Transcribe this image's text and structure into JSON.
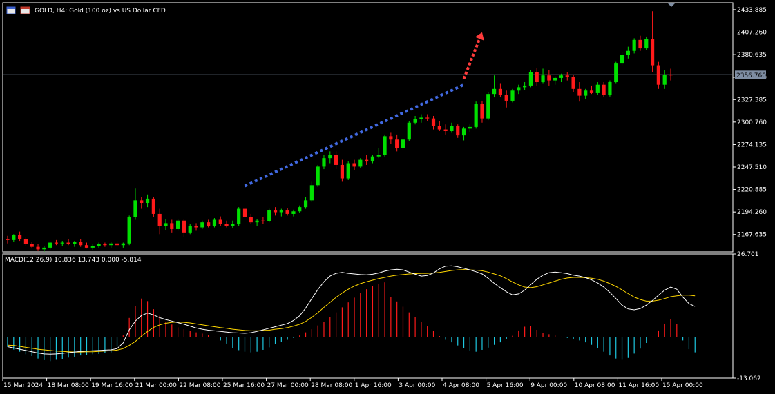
{
  "header": {
    "title": "GOLD, H4:  Gold (100 oz) vs US Dollar CFD"
  },
  "colors": {
    "background": "#000000",
    "bull": "#00e000",
    "bear": "#ff1a1a",
    "grid": "#6e6e6e",
    "current_price_line": "#7f8ea3",
    "support_trendline": "#4169e1",
    "projection_arrow": "#ff3b3b",
    "macd_main": "#ffffff",
    "macd_signal": "#ffd700",
    "hist_positive": "#ff1a1a",
    "hist_negative": "#1ec8e0"
  },
  "price_panel": {
    "current_price": "2356.760",
    "y_ticks": [
      "2433.885",
      "2407.260",
      "2380.635",
      "2353.760",
      "2327.385",
      "2300.760",
      "2274.135",
      "2247.510",
      "2220.885",
      "2194.260",
      "2167.635"
    ]
  },
  "macd_panel": {
    "label": "MACD(12,26,9) 10.836 13.743 0.000 -5.814",
    "y_ticks": [
      "26.701",
      "-13.062"
    ]
  },
  "x_axis": {
    "labels": [
      "15 Mar 2024",
      "18 Mar 08:00",
      "19 Mar 16:00",
      "21 Mar 00:00",
      "22 Mar 08:00",
      "25 Mar 16:00",
      "27 Mar 00:00",
      "28 Mar 08:00",
      "1 Apr 16:00",
      "3 Apr 00:00",
      "4 Apr 08:00",
      "5 Apr 16:00",
      "9 Apr 00:00",
      "10 Apr 08:00",
      "11 Apr 16:00",
      "15 Apr 00:00"
    ]
  },
  "chart_data": [
    {
      "type": "candlestick",
      "title": "GOLD, H4:  Gold (100 oz) vs US Dollar CFD",
      "x_labels": [
        "15 Mar 2024",
        "18 Mar 08:00",
        "19 Mar 16:00",
        "21 Mar 00:00",
        "22 Mar 08:00",
        "25 Mar 16:00",
        "27 Mar 00:00",
        "28 Mar 08:00",
        "1 Apr 16:00",
        "3 Apr 00:00",
        "4 Apr 08:00",
        "5 Apr 16:00",
        "9 Apr 00:00",
        "10 Apr 08:00",
        "11 Apr 16:00",
        "15 Apr 00:00"
      ],
      "ylim": [
        2147,
        2442
      ],
      "current_price": 2356.76,
      "grid": false,
      "trendline": {
        "name": "support",
        "from": [
          39,
          2225
        ],
        "to": [
          75,
          2345
        ]
      },
      "arrow": {
        "from": [
          75,
          2352
        ],
        "to": [
          78,
          2407
        ]
      },
      "series": [
        {
          "o": 2162,
          "h": 2166,
          "l": 2157,
          "c": 2161
        },
        {
          "o": 2161,
          "h": 2168,
          "l": 2159,
          "c": 2167
        },
        {
          "o": 2167,
          "h": 2171,
          "l": 2160,
          "c": 2162
        },
        {
          "o": 2162,
          "h": 2164,
          "l": 2154,
          "c": 2156
        },
        {
          "o": 2156,
          "h": 2159,
          "l": 2151,
          "c": 2153
        },
        {
          "o": 2153,
          "h": 2156,
          "l": 2148,
          "c": 2150
        },
        {
          "o": 2150,
          "h": 2154,
          "l": 2147,
          "c": 2152
        },
        {
          "o": 2152,
          "h": 2159,
          "l": 2150,
          "c": 2158
        },
        {
          "o": 2158,
          "h": 2161,
          "l": 2155,
          "c": 2157
        },
        {
          "o": 2157,
          "h": 2160,
          "l": 2154,
          "c": 2158
        },
        {
          "o": 2158,
          "h": 2162,
          "l": 2155,
          "c": 2156
        },
        {
          "o": 2156,
          "h": 2160,
          "l": 2153,
          "c": 2159
        },
        {
          "o": 2159,
          "h": 2162,
          "l": 2153,
          "c": 2155
        },
        {
          "o": 2155,
          "h": 2158,
          "l": 2151,
          "c": 2152
        },
        {
          "o": 2152,
          "h": 2156,
          "l": 2149,
          "c": 2154
        },
        {
          "o": 2154,
          "h": 2158,
          "l": 2152,
          "c": 2156
        },
        {
          "o": 2156,
          "h": 2158,
          "l": 2153,
          "c": 2155
        },
        {
          "o": 2155,
          "h": 2159,
          "l": 2152,
          "c": 2157
        },
        {
          "o": 2157,
          "h": 2160,
          "l": 2154,
          "c": 2155
        },
        {
          "o": 2155,
          "h": 2158,
          "l": 2152,
          "c": 2157
        },
        {
          "o": 2157,
          "h": 2190,
          "l": 2155,
          "c": 2188
        },
        {
          "o": 2188,
          "h": 2222,
          "l": 2185,
          "c": 2208
        },
        {
          "o": 2208,
          "h": 2212,
          "l": 2198,
          "c": 2205
        },
        {
          "o": 2205,
          "h": 2215,
          "l": 2200,
          "c": 2210
        },
        {
          "o": 2210,
          "h": 2212,
          "l": 2188,
          "c": 2192
        },
        {
          "o": 2192,
          "h": 2198,
          "l": 2168,
          "c": 2178
        },
        {
          "o": 2178,
          "h": 2186,
          "l": 2173,
          "c": 2181
        },
        {
          "o": 2181,
          "h": 2185,
          "l": 2170,
          "c": 2174
        },
        {
          "o": 2174,
          "h": 2186,
          "l": 2172,
          "c": 2184
        },
        {
          "o": 2184,
          "h": 2186,
          "l": 2165,
          "c": 2170
        },
        {
          "o": 2170,
          "h": 2180,
          "l": 2168,
          "c": 2178
        },
        {
          "o": 2178,
          "h": 2181,
          "l": 2172,
          "c": 2176
        },
        {
          "o": 2176,
          "h": 2184,
          "l": 2174,
          "c": 2182
        },
        {
          "o": 2182,
          "h": 2185,
          "l": 2176,
          "c": 2178
        },
        {
          "o": 2178,
          "h": 2187,
          "l": 2176,
          "c": 2185
        },
        {
          "o": 2185,
          "h": 2189,
          "l": 2178,
          "c": 2180
        },
        {
          "o": 2180,
          "h": 2184,
          "l": 2176,
          "c": 2178
        },
        {
          "o": 2178,
          "h": 2184,
          "l": 2175,
          "c": 2180
        },
        {
          "o": 2180,
          "h": 2200,
          "l": 2178,
          "c": 2198
        },
        {
          "o": 2198,
          "h": 2202,
          "l": 2186,
          "c": 2188
        },
        {
          "o": 2188,
          "h": 2192,
          "l": 2180,
          "c": 2182
        },
        {
          "o": 2182,
          "h": 2186,
          "l": 2178,
          "c": 2184
        },
        {
          "o": 2184,
          "h": 2188,
          "l": 2180,
          "c": 2183
        },
        {
          "o": 2183,
          "h": 2198,
          "l": 2182,
          "c": 2196
        },
        {
          "o": 2196,
          "h": 2200,
          "l": 2190,
          "c": 2194
        },
        {
          "o": 2194,
          "h": 2198,
          "l": 2189,
          "c": 2196
        },
        {
          "o": 2196,
          "h": 2199,
          "l": 2190,
          "c": 2192
        },
        {
          "o": 2192,
          "h": 2197,
          "l": 2189,
          "c": 2195
        },
        {
          "o": 2195,
          "h": 2202,
          "l": 2193,
          "c": 2200
        },
        {
          "o": 2200,
          "h": 2212,
          "l": 2198,
          "c": 2208
        },
        {
          "o": 2208,
          "h": 2230,
          "l": 2206,
          "c": 2226
        },
        {
          "o": 2226,
          "h": 2250,
          "l": 2224,
          "c": 2248
        },
        {
          "o": 2248,
          "h": 2262,
          "l": 2245,
          "c": 2258
        },
        {
          "o": 2258,
          "h": 2266,
          "l": 2252,
          "c": 2262
        },
        {
          "o": 2262,
          "h": 2266,
          "l": 2245,
          "c": 2250
        },
        {
          "o": 2250,
          "h": 2256,
          "l": 2230,
          "c": 2234
        },
        {
          "o": 2234,
          "h": 2254,
          "l": 2232,
          "c": 2252
        },
        {
          "o": 2252,
          "h": 2256,
          "l": 2244,
          "c": 2248
        },
        {
          "o": 2248,
          "h": 2258,
          "l": 2246,
          "c": 2256
        },
        {
          "o": 2256,
          "h": 2262,
          "l": 2250,
          "c": 2254
        },
        {
          "o": 2254,
          "h": 2262,
          "l": 2252,
          "c": 2260
        },
        {
          "o": 2260,
          "h": 2270,
          "l": 2258,
          "c": 2262
        },
        {
          "o": 2262,
          "h": 2286,
          "l": 2260,
          "c": 2284
        },
        {
          "o": 2284,
          "h": 2288,
          "l": 2275,
          "c": 2280
        },
        {
          "o": 2280,
          "h": 2286,
          "l": 2266,
          "c": 2270
        },
        {
          "o": 2270,
          "h": 2282,
          "l": 2268,
          "c": 2280
        },
        {
          "o": 2280,
          "h": 2302,
          "l": 2278,
          "c": 2300
        },
        {
          "o": 2300,
          "h": 2308,
          "l": 2298,
          "c": 2304
        },
        {
          "o": 2304,
          "h": 2310,
          "l": 2300,
          "c": 2306
        },
        {
          "o": 2306,
          "h": 2310,
          "l": 2302,
          "c": 2305
        },
        {
          "o": 2305,
          "h": 2308,
          "l": 2292,
          "c": 2296
        },
        {
          "o": 2296,
          "h": 2302,
          "l": 2290,
          "c": 2292
        },
        {
          "o": 2292,
          "h": 2298,
          "l": 2286,
          "c": 2290
        },
        {
          "o": 2290,
          "h": 2300,
          "l": 2288,
          "c": 2296
        },
        {
          "o": 2296,
          "h": 2298,
          "l": 2282,
          "c": 2285
        },
        {
          "o": 2285,
          "h": 2295,
          "l": 2279,
          "c": 2293
        },
        {
          "o": 2293,
          "h": 2298,
          "l": 2289,
          "c": 2295
        },
        {
          "o": 2295,
          "h": 2325,
          "l": 2293,
          "c": 2322
        },
        {
          "o": 2322,
          "h": 2326,
          "l": 2300,
          "c": 2305
        },
        {
          "o": 2305,
          "h": 2336,
          "l": 2303,
          "c": 2334
        },
        {
          "o": 2334,
          "h": 2356,
          "l": 2330,
          "c": 2340
        },
        {
          "o": 2340,
          "h": 2346,
          "l": 2330,
          "c": 2333
        },
        {
          "o": 2333,
          "h": 2338,
          "l": 2318,
          "c": 2326
        },
        {
          "o": 2326,
          "h": 2340,
          "l": 2324,
          "c": 2338
        },
        {
          "o": 2338,
          "h": 2345,
          "l": 2334,
          "c": 2342
        },
        {
          "o": 2342,
          "h": 2348,
          "l": 2339,
          "c": 2344
        },
        {
          "o": 2344,
          "h": 2362,
          "l": 2342,
          "c": 2360
        },
        {
          "o": 2360,
          "h": 2365,
          "l": 2344,
          "c": 2348
        },
        {
          "o": 2348,
          "h": 2364,
          "l": 2346,
          "c": 2356
        },
        {
          "o": 2356,
          "h": 2362,
          "l": 2344,
          "c": 2350
        },
        {
          "o": 2350,
          "h": 2355,
          "l": 2345,
          "c": 2353
        },
        {
          "o": 2353,
          "h": 2358,
          "l": 2348,
          "c": 2356
        },
        {
          "o": 2356,
          "h": 2360,
          "l": 2350,
          "c": 2354
        },
        {
          "o": 2354,
          "h": 2357,
          "l": 2336,
          "c": 2340
        },
        {
          "o": 2340,
          "h": 2348,
          "l": 2325,
          "c": 2332
        },
        {
          "o": 2332,
          "h": 2340,
          "l": 2328,
          "c": 2338
        },
        {
          "o": 2338,
          "h": 2344,
          "l": 2334,
          "c": 2335
        },
        {
          "o": 2335,
          "h": 2348,
          "l": 2333,
          "c": 2345
        },
        {
          "o": 2345,
          "h": 2348,
          "l": 2330,
          "c": 2333
        },
        {
          "o": 2333,
          "h": 2350,
          "l": 2331,
          "c": 2348
        },
        {
          "o": 2348,
          "h": 2372,
          "l": 2346,
          "c": 2370
        },
        {
          "o": 2370,
          "h": 2384,
          "l": 2368,
          "c": 2380
        },
        {
          "o": 2380,
          "h": 2390,
          "l": 2376,
          "c": 2385
        },
        {
          "o": 2385,
          "h": 2400,
          "l": 2382,
          "c": 2398
        },
        {
          "o": 2398,
          "h": 2403,
          "l": 2385,
          "c": 2388
        },
        {
          "o": 2388,
          "h": 2402,
          "l": 2386,
          "c": 2399
        },
        {
          "o": 2399,
          "h": 2432,
          "l": 2360,
          "c": 2368
        },
        {
          "o": 2368,
          "h": 2372,
          "l": 2340,
          "c": 2345
        },
        {
          "o": 2345,
          "h": 2362,
          "l": 2340,
          "c": 2357
        },
        {
          "o": 2357,
          "h": 2364,
          "l": 2350,
          "c": 2356
        }
      ]
    },
    {
      "type": "macd",
      "title": "MACD(12,26,9) 10.836 13.743 0.000 -5.814",
      "ylim": [
        -13.062,
        26.701
      ],
      "zero_line_value": 0,
      "main": [
        -3,
        -3.4,
        -3.8,
        -4.2,
        -4.6,
        -5.0,
        -5.3,
        -5.4,
        -5.3,
        -5.1,
        -4.9,
        -4.7,
        -4.5,
        -4.4,
        -4.3,
        -4.2,
        -4.1,
        -4.0,
        -3.6,
        -1.8,
        2.4,
        5.2,
        7.0,
        7.8,
        7.2,
        6.3,
        5.7,
        5.2,
        4.7,
        4.2,
        3.6,
        3.0,
        2.6,
        2.3,
        2.1,
        1.9,
        1.7,
        1.5,
        1.4,
        1.3,
        1.5,
        1.9,
        2.4,
        2.9,
        3.4,
        3.9,
        4.4,
        5.4,
        6.9,
        9.4,
        12.4,
        15.3,
        17.8,
        19.6,
        20.5,
        20.8,
        20.5,
        20.3,
        20.1,
        20.0,
        20.2,
        20.6,
        21.2,
        21.6,
        21.8,
        21.6,
        20.9,
        20.2,
        19.6,
        19.8,
        20.6,
        21.9,
        22.8,
        22.9,
        22.6,
        22.1,
        21.6,
        21.0,
        20.3,
        18.9,
        17.3,
        15.9,
        14.6,
        13.6,
        13.9,
        15.1,
        16.9,
        18.6,
        19.9,
        20.7,
        20.9,
        20.7,
        20.4,
        19.9,
        19.6,
        19.1,
        18.4,
        17.4,
        16.1,
        14.4,
        12.4,
        10.3,
        9.1,
        8.8,
        9.2,
        10.3,
        11.8,
        13.5,
        15.1,
        16.1,
        15.4,
        12.9,
        10.8,
        9.9
      ],
      "signal": [
        -2.5,
        -2.6,
        -2.9,
        -3.2,
        -3.5,
        -3.8,
        -4.0,
        -4.2,
        -4.4,
        -4.5,
        -4.6,
        -4.7,
        -4.7,
        -4.6,
        -4.6,
        -4.5,
        -4.4,
        -4.3,
        -4.1,
        -3.6,
        -2.6,
        -1.3,
        0.4,
        1.9,
        3.2,
        4.0,
        4.5,
        4.8,
        4.9,
        4.8,
        4.6,
        4.3,
        4.0,
        3.7,
        3.4,
        3.1,
        2.9,
        2.6,
        2.4,
        2.2,
        2.1,
        2.1,
        2.2,
        2.3,
        2.6,
        2.8,
        3.1,
        3.6,
        4.2,
        5.1,
        6.4,
        7.9,
        9.6,
        11.2,
        12.8,
        14.2,
        15.4,
        16.4,
        17.2,
        17.8,
        18.3,
        18.8,
        19.2,
        19.6,
        19.9,
        20.1,
        20.3,
        20.4,
        20.5,
        20.5,
        20.6,
        20.8,
        21.1,
        21.4,
        21.6,
        21.7,
        21.6,
        21.5,
        21.3,
        20.9,
        20.3,
        19.7,
        18.8,
        17.7,
        16.8,
        16.1,
        15.9,
        16.2,
        16.8,
        17.4,
        18.0,
        18.6,
        19.0,
        19.2,
        19.2,
        19.1,
        18.9,
        18.6,
        18.0,
        17.2,
        16.3,
        15.2,
        14.0,
        12.9,
        12.1,
        11.6,
        11.6,
        11.9,
        12.4,
        13.0,
        13.3,
        13.5,
        13.5,
        13.3
      ],
      "histogram": [
        -3.1,
        -3.9,
        -4.6,
        -5.4,
        -6.0,
        -6.8,
        -7.3,
        -7.6,
        -7.2,
        -6.9,
        -6.5,
        -6.2,
        -5.8,
        -5.6,
        -5.4,
        -5.3,
        -5.0,
        -4.8,
        -3.0,
        0.6,
        6.2,
        10.1,
        12.4,
        11.6,
        9.0,
        6.9,
        5.0,
        4.1,
        3.2,
        2.6,
        2.0,
        1.6,
        1.2,
        0.8,
        0.2,
        -1.0,
        -2.0,
        -3.4,
        -4.1,
        -4.6,
        -4.8,
        -4.6,
        -4.0,
        -3.2,
        -2.2,
        -1.5,
        -0.8,
        -0.2,
        0.6,
        1.6,
        2.6,
        3.8,
        5.0,
        6.4,
        8.0,
        9.6,
        11.2,
        12.7,
        14.2,
        15.4,
        16.4,
        17.2,
        17.6,
        13.0,
        11.5,
        9.8,
        8.0,
        6.4,
        5.0,
        3.5,
        2.0,
        0.4,
        -0.8,
        -1.6,
        -2.6,
        -3.4,
        -4.2,
        -4.6,
        -4.0,
        -3.3,
        -2.4,
        -1.6,
        -0.6,
        0.5,
        2.2,
        3.4,
        3.6,
        2.4,
        1.5,
        1.0,
        0.6,
        0.2,
        -0.2,
        -0.6,
        -1.0,
        -1.6,
        -2.4,
        -3.4,
        -4.6,
        -5.8,
        -6.8,
        -7.2,
        -6.6,
        -5.2,
        -3.6,
        -1.8,
        0.2,
        2.2,
        4.4,
        5.8,
        4.2,
        -1.0,
        -3.8,
        -4.8
      ]
    }
  ]
}
